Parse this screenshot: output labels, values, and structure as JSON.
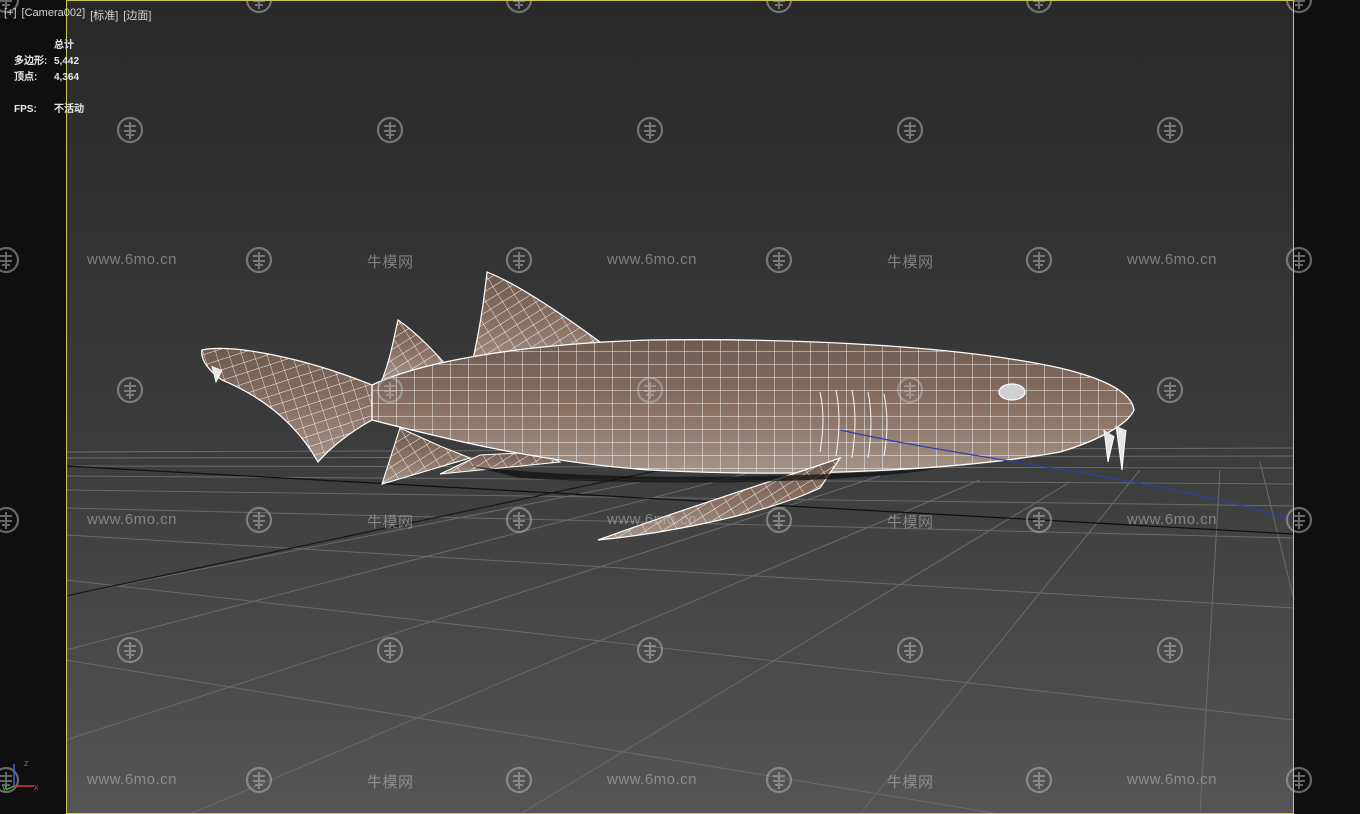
{
  "viewport": {
    "header": {
      "plus_label": "[+]",
      "camera_label": "[Camera002]",
      "shading_mode_label": "[标准]",
      "display_mode_label": "[边面]"
    },
    "stats": {
      "total_label": "总计",
      "polygons_label": "多边形:",
      "polygons_value": "5,442",
      "vertices_label": "顶点:",
      "vertices_value": "4,364",
      "fps_label": "FPS:",
      "fps_value": "不活动"
    },
    "axis_gizmo": {
      "z_label": "z",
      "y_label": "y",
      "x_label": "x"
    }
  },
  "watermark": {
    "url_text": "www.6mo.cn",
    "site_text": "牛模网",
    "logo_icon": "niumo-logo-icon"
  },
  "colors": {
    "safe_frame": "#c8c84a",
    "grid_line": "#6a6a6a",
    "wireframe": "#ffffff",
    "shark_skin": "#7a6355",
    "spline": "#2f3fa8",
    "background_top": "#2a2a2a",
    "background_bottom": "#545454"
  }
}
